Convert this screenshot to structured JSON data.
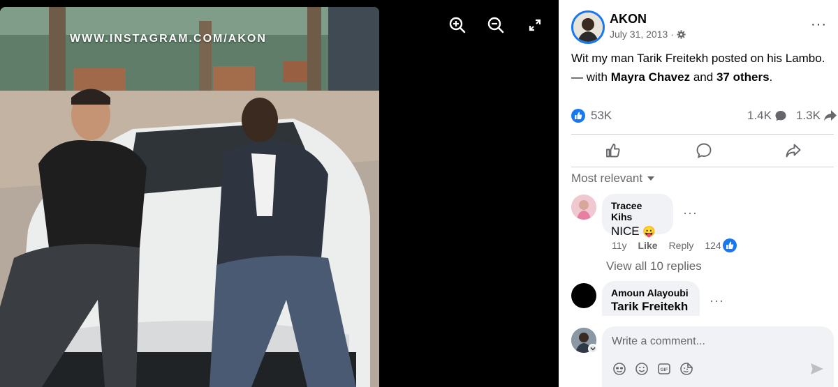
{
  "viewer": {
    "watermark": "WWW.INSTAGRAM.COM/AKON",
    "buttons": [
      "zoom-in-icon",
      "zoom-out-icon",
      "fullscreen-icon"
    ]
  },
  "post": {
    "author": "AKON",
    "date": "July 31, 2013",
    "date_separator": "·",
    "more": "···",
    "caption_text": "Wit my man Tarik Freitekh posted on his Lambo.",
    "tag_prefix": "— with",
    "tag_person": "Mayra Chavez",
    "tag_and": "and",
    "tag_others": "37 others",
    "tag_end": "."
  },
  "stats": {
    "likes": "53K",
    "comments": "1.4K",
    "shares": "1.3K"
  },
  "actions": [
    "like-icon",
    "comment-icon",
    "share-icon"
  ],
  "sort_label": "Most relevant",
  "comments": [
    {
      "name": "Tracee Kihs",
      "text": "NICE",
      "emoji": "😛",
      "age": "11y",
      "like": "Like",
      "reply": "Reply",
      "reactions": "124"
    },
    {
      "name": "Amoun Alayoubi",
      "text": "Tarik Freitekh"
    }
  ],
  "view_replies": "View all 10 replies",
  "writer": {
    "placeholder": "Write a comment..."
  },
  "colors": {
    "accent": "#1877f2",
    "muted": "#65676b",
    "bubble": "#f0f2f5"
  }
}
